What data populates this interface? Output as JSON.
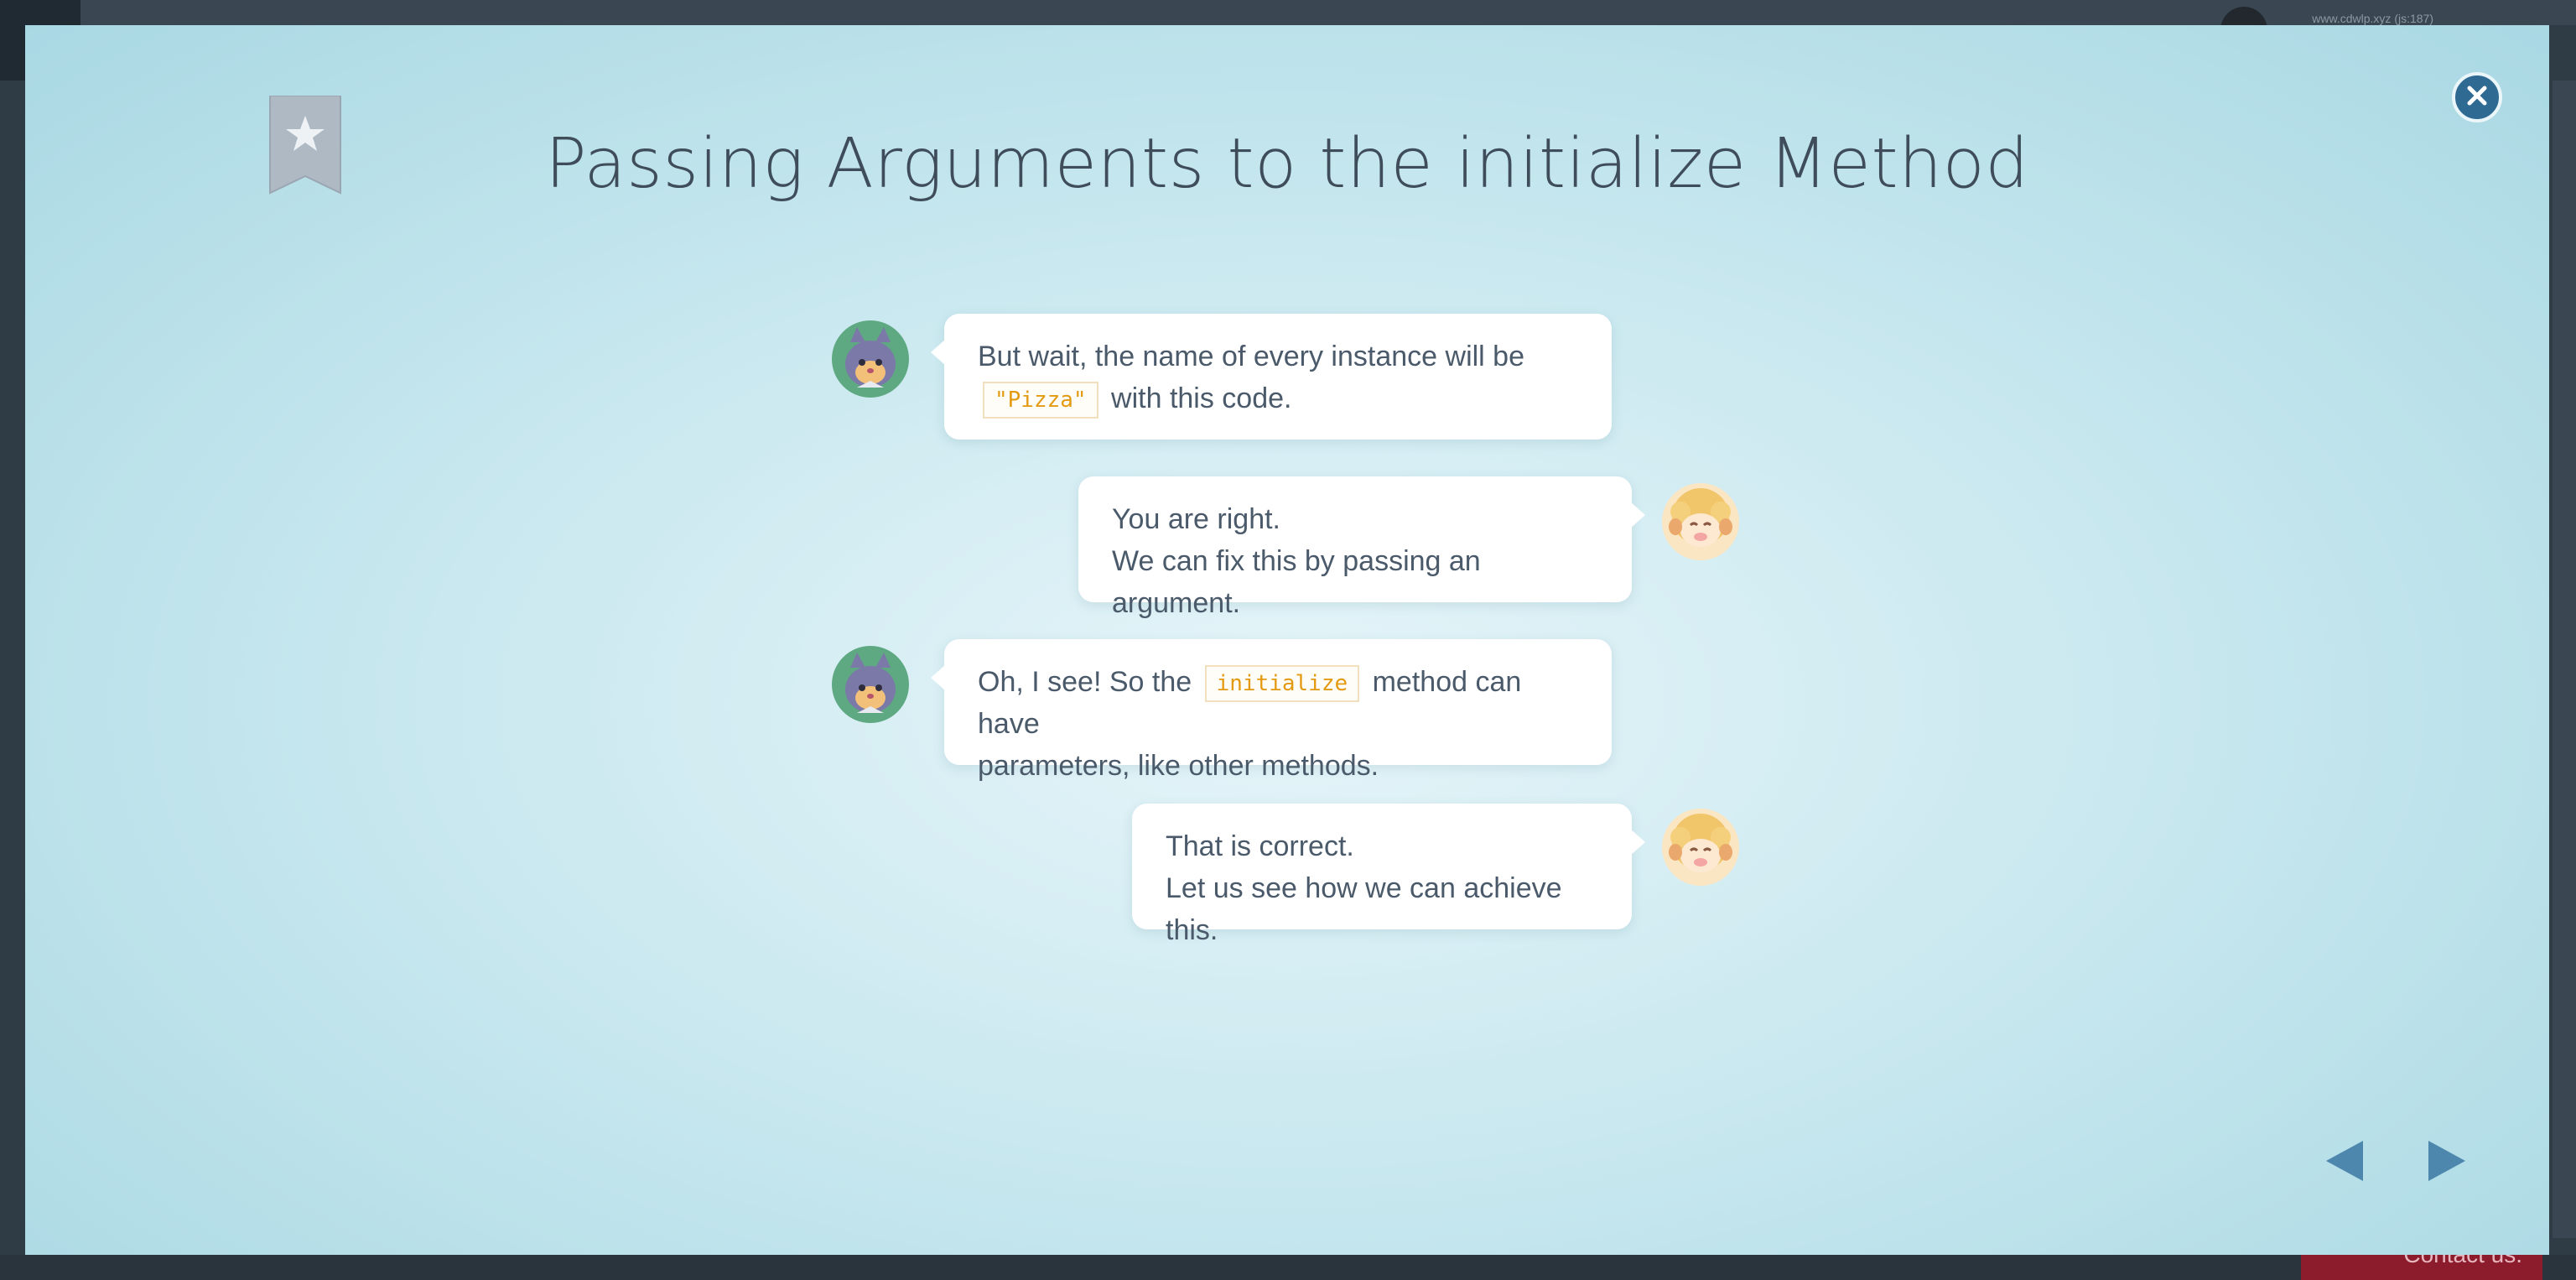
{
  "background": {
    "url_text": "www.cdwlp.xyz (js:187)",
    "contact_label": "Contact us."
  },
  "modal": {
    "title": "Passing Arguments to the initialize Method",
    "close_icon": "close-icon",
    "bookmark_icon": "bookmark-star-icon",
    "colors": {
      "accent": "#2f6a93",
      "code_text": "#e39a12",
      "bubble": "#ffffff",
      "title": "#3e4d59"
    }
  },
  "conversation": [
    {
      "speaker": "cat",
      "side": "left",
      "parts": [
        {
          "text": "But wait, the name of every instance will be"
        },
        {
          "code": "\"Pizza\""
        },
        {
          "text": "with this code."
        }
      ]
    },
    {
      "speaker": "sheep",
      "side": "right",
      "lines": [
        "You are right.",
        "We can fix this by passing an argument."
      ]
    },
    {
      "speaker": "cat",
      "side": "left",
      "parts": [
        {
          "text": "Oh, I see! So the"
        },
        {
          "code": "initialize"
        },
        {
          "text": "method can have"
        },
        {
          "text": "parameters, like other methods."
        }
      ]
    },
    {
      "speaker": "sheep",
      "side": "right",
      "lines": [
        "That is correct.",
        "Let us see how we can achieve this."
      ]
    }
  ],
  "navigation": {
    "prev_icon": "triangle-left-icon",
    "next_icon": "triangle-right-icon"
  }
}
